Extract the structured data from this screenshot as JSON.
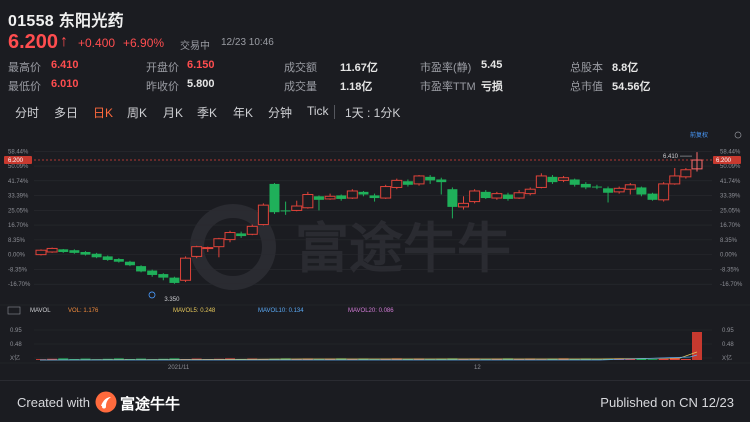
{
  "header": {
    "code": "01558",
    "name": "东阳光药",
    "price": "6.200",
    "change": "+0.400",
    "change_pct": "+6.90%",
    "status": "交易中",
    "time": "12/23 10:46"
  },
  "stats": [
    {
      "label": "最高价",
      "value": "6.410",
      "color": "#ff4d4f"
    },
    {
      "label": "开盘价",
      "value": "6.150",
      "color": "#ff4d4f"
    },
    {
      "label": "成交额",
      "value": "11.67亿",
      "color": "#e6e6e6"
    },
    {
      "label": "市盈率(静)",
      "value": "5.45",
      "color": "#e6e6e6"
    },
    {
      "label": "总股本",
      "value": "8.8亿",
      "color": "#e6e6e6"
    },
    {
      "label": "最低价",
      "value": "6.010",
      "color": "#ff4d4f"
    },
    {
      "label": "昨收价",
      "value": "5.800",
      "color": "#e6e6e6"
    },
    {
      "label": "成交量",
      "value": "1.18亿",
      "color": "#e6e6e6"
    },
    {
      "label": "市盈率TTM",
      "value": "亏损",
      "color": "#e6e6e6"
    },
    {
      "label": "总市值",
      "value": "54.56亿",
      "color": "#e6e6e6"
    }
  ],
  "tabs": [
    "分时",
    "多日",
    "日K",
    "周K",
    "月K",
    "季K",
    "年K",
    "分钟",
    "Tick",
    "1天 : 1分K"
  ],
  "active_tab": "日K",
  "chart_data": {
    "type": "candlestick",
    "y_axis_left_ticks": [
      "58.44%",
      "50.09%",
      "41.74%",
      "33.39%",
      "25.05%",
      "16.70%",
      "8.35%",
      "0.00%",
      "-8.35%",
      "-16.70%"
    ],
    "y_axis_right_ticks": [
      "58.44%",
      "50.09%",
      "41.74%",
      "33.39%",
      "25.05%",
      "16.70%",
      "8.35%",
      "0.00%",
      "-8.35%",
      "-16.70%"
    ],
    "current_price_label": "6.200",
    "high_label": "6.410",
    "low_label": "3.350",
    "adjust_label": "前复权",
    "ylim_pct": [
      -20,
      62
    ],
    "candles": [
      {
        "o": 0.0,
        "c": 2.5,
        "h": 3.0,
        "l": -0.5
      },
      {
        "o": 1.5,
        "c": 3.5,
        "h": 4.0,
        "l": 1.0
      },
      {
        "o": 3.0,
        "c": 1.5,
        "h": 3.2,
        "l": 1.0
      },
      {
        "o": 2.5,
        "c": 1.0,
        "h": 3.0,
        "l": 0.5
      },
      {
        "o": 1.5,
        "c": 0.0,
        "h": 2.0,
        "l": -0.5
      },
      {
        "o": 0.5,
        "c": -1.5,
        "h": 1.0,
        "l": -2.0
      },
      {
        "o": -1.0,
        "c": -3.0,
        "h": -0.5,
        "l": -3.5
      },
      {
        "o": -2.5,
        "c": -4.0,
        "h": -2.0,
        "l": -4.5
      },
      {
        "o": -4.0,
        "c": -6.0,
        "h": -3.5,
        "l": -6.5
      },
      {
        "o": -6.5,
        "c": -9.5,
        "h": -6.0,
        "l": -10.0
      },
      {
        "o": -9.0,
        "c": -11.5,
        "h": -8.5,
        "l": -12.5
      },
      {
        "o": -11.0,
        "c": -13.0,
        "h": -10.5,
        "l": -14.5
      },
      {
        "o": -13.0,
        "c": -16.0,
        "h": -12.5,
        "l": -16.5
      },
      {
        "o": -14.5,
        "c": -2.0,
        "h": -1.0,
        "l": -15.5
      },
      {
        "o": -1.0,
        "c": 4.5,
        "h": 5.0,
        "l": -2.0
      },
      {
        "o": 4.0,
        "c": 4.0,
        "h": 4.5,
        "l": 1.5
      },
      {
        "o": 4.5,
        "c": 9.0,
        "h": 9.5,
        "l": -1.5
      },
      {
        "o": 8.5,
        "c": 12.5,
        "h": 13.5,
        "l": 7.0
      },
      {
        "o": 12.0,
        "c": 10.5,
        "h": 13.0,
        "l": 9.5
      },
      {
        "o": 11.5,
        "c": 16.0,
        "h": 17.0,
        "l": 11.0
      },
      {
        "o": 17.0,
        "c": 28.0,
        "h": 29.0,
        "l": 16.5
      },
      {
        "o": 40.0,
        "c": 24.0,
        "h": 40.5,
        "l": 23.0
      },
      {
        "o": 25.0,
        "c": 24.5,
        "h": 30.0,
        "l": 22.5
      },
      {
        "o": 25.0,
        "c": 27.5,
        "h": 30.5,
        "l": 24.5
      },
      {
        "o": 26.5,
        "c": 34.0,
        "h": 35.5,
        "l": 26.0
      },
      {
        "o": 33.0,
        "c": 31.0,
        "h": 33.5,
        "l": 25.0
      },
      {
        "o": 31.5,
        "c": 33.0,
        "h": 34.5,
        "l": 31.0
      },
      {
        "o": 33.5,
        "c": 31.5,
        "h": 34.0,
        "l": 30.5
      },
      {
        "o": 32.0,
        "c": 36.0,
        "h": 37.0,
        "l": 31.5
      },
      {
        "o": 35.5,
        "c": 34.0,
        "h": 36.0,
        "l": 33.0
      },
      {
        "o": 33.5,
        "c": 32.0,
        "h": 34.5,
        "l": 30.0
      },
      {
        "o": 32.0,
        "c": 38.5,
        "h": 39.5,
        "l": 31.5
      },
      {
        "o": 38.0,
        "c": 42.0,
        "h": 43.0,
        "l": 37.0
      },
      {
        "o": 41.5,
        "c": 39.5,
        "h": 42.5,
        "l": 38.5
      },
      {
        "o": 40.0,
        "c": 44.5,
        "h": 45.0,
        "l": 39.0
      },
      {
        "o": 44.0,
        "c": 42.0,
        "h": 45.0,
        "l": 40.0
      },
      {
        "o": 42.5,
        "c": 41.0,
        "h": 43.5,
        "l": 34.0
      },
      {
        "o": 37.0,
        "c": 27.0,
        "h": 38.0,
        "l": 20.5
      },
      {
        "o": 27.0,
        "c": 29.0,
        "h": 33.0,
        "l": 25.5
      },
      {
        "o": 30.0,
        "c": 36.0,
        "h": 37.0,
        "l": 29.0
      },
      {
        "o": 35.5,
        "c": 32.0,
        "h": 36.5,
        "l": 31.5
      },
      {
        "o": 32.0,
        "c": 34.5,
        "h": 35.5,
        "l": 31.0
      },
      {
        "o": 34.0,
        "c": 31.5,
        "h": 35.0,
        "l": 30.5
      },
      {
        "o": 32.0,
        "c": 35.0,
        "h": 36.5,
        "l": 31.5
      },
      {
        "o": 34.5,
        "c": 37.0,
        "h": 38.0,
        "l": 33.5
      },
      {
        "o": 38.0,
        "c": 44.5,
        "h": 46.0,
        "l": 37.5
      },
      {
        "o": 44.0,
        "c": 41.0,
        "h": 45.0,
        "l": 40.0
      },
      {
        "o": 42.0,
        "c": 43.5,
        "h": 44.5,
        "l": 41.0
      },
      {
        "o": 42.5,
        "c": 39.5,
        "h": 43.0,
        "l": 38.5
      },
      {
        "o": 40.0,
        "c": 38.0,
        "h": 41.0,
        "l": 37.0
      },
      {
        "o": 38.5,
        "c": 38.0,
        "h": 39.5,
        "l": 37.0
      },
      {
        "o": 37.5,
        "c": 35.0,
        "h": 38.5,
        "l": 29.5
      },
      {
        "o": 35.5,
        "c": 37.5,
        "h": 38.5,
        "l": 34.5
      },
      {
        "o": 37.0,
        "c": 39.5,
        "h": 40.5,
        "l": 34.0
      },
      {
        "o": 38.0,
        "c": 34.0,
        "h": 38.5,
        "l": 33.0
      },
      {
        "o": 34.5,
        "c": 31.0,
        "h": 35.0,
        "l": 30.5
      },
      {
        "o": 31.0,
        "c": 40.0,
        "h": 41.0,
        "l": 30.0
      },
      {
        "o": 40.0,
        "c": 44.5,
        "h": 49.0,
        "l": 39.5
      },
      {
        "o": 44.0,
        "c": 48.0,
        "h": 49.0,
        "l": 43.0
      },
      {
        "o": 48.5,
        "c": 53.5,
        "h": 58.0,
        "l": 47.0
      }
    ],
    "volume": {
      "label_mavol": "MAVOL",
      "vol_label": "VOL: 1.176",
      "mavol5_label": "MAVOL5: 0.248",
      "mavol10_label": "MAVOL10: 0.134",
      "mavol20_label": "MAVOL20: 0.086",
      "left_ticks": [
        "0.95",
        "0.48",
        "X亿"
      ],
      "right_ticks": [
        "0.95",
        "0.48",
        "X亿"
      ],
      "last_value": 0.95
    },
    "x_labels": [
      "2021/11",
      "12"
    ]
  },
  "watermark": "富途牛牛",
  "footer": {
    "created": "Created with",
    "brand": "富途牛牛",
    "published": "Published on CN 12/23"
  },
  "colors": {
    "up": "#e0433a",
    "down": "#1fb05a",
    "accent": "#ff6a3d"
  }
}
